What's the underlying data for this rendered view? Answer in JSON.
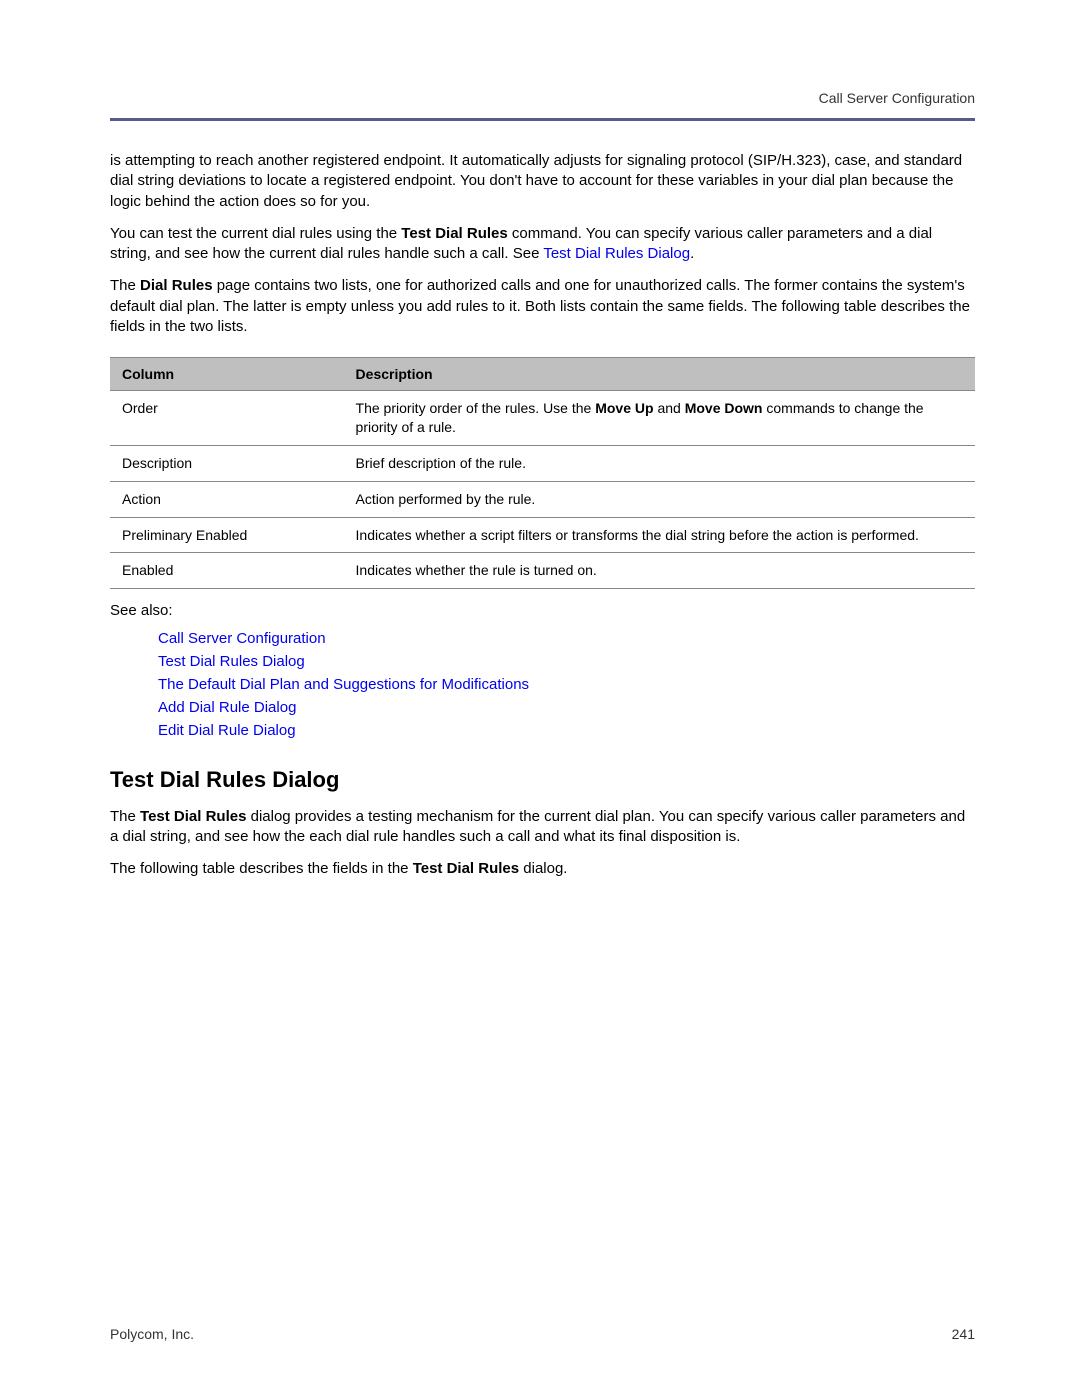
{
  "header": {
    "section": "Call Server Configuration"
  },
  "paragraphs": {
    "p1": "is attempting to reach another registered endpoint. It automatically adjusts for signaling protocol (SIP/H.323), case, and standard dial string deviations to locate a registered endpoint. You don't have to account for these variables in your dial plan because the logic behind the action does so for you.",
    "p2_a": "You can test the current dial rules using the ",
    "p2_bold": "Test Dial Rules",
    "p2_b": " command. You can specify various caller parameters and a dial string, and see how the current dial rules handle such a call. See ",
    "p2_link": "Test Dial Rules Dialog",
    "p2_c": ".",
    "p3_a": "The ",
    "p3_bold": "Dial Rules",
    "p3_b": " page contains two lists, one for authorized calls and one for unauthorized calls. The former contains the system's default dial plan. The latter is empty unless you add rules to it. Both lists contain the same fields. The following table describes the fields in the two lists.",
    "see_also_label": "See also:",
    "p4_a": "The ",
    "p4_bold": "Test Dial Rules",
    "p4_b": " dialog provides a testing mechanism for the current dial plan. You can specify various caller parameters and a dial string, and see how the each dial rule handles such a call and what its final disposition is.",
    "p5_a": "The following table describes the fields in the ",
    "p5_bold": "Test Dial Rules",
    "p5_b": " dialog."
  },
  "table": {
    "headers": {
      "c1": "Column",
      "c2": "Description"
    },
    "rows": [
      {
        "c1": "Order",
        "c2_a": "The priority order of the rules. Use the ",
        "c2_b1": "Move Up",
        "c2_mid": " and ",
        "c2_b2": "Move Down",
        "c2_b": " commands to change the priority of a rule."
      },
      {
        "c1": "Description",
        "c2": "Brief description of the rule."
      },
      {
        "c1": "Action",
        "c2": "Action performed by the rule."
      },
      {
        "c1": "Preliminary Enabled",
        "c2": "Indicates whether a script filters or transforms the dial string before the action is performed."
      },
      {
        "c1": "Enabled",
        "c2": "Indicates whether the rule is turned on."
      }
    ]
  },
  "see_also": [
    "Call Server Configuration",
    "Test Dial Rules Dialog",
    "The Default Dial Plan and Suggestions for Modifications",
    "Add Dial Rule Dialog",
    "Edit Dial Rule Dialog"
  ],
  "heading": "Test Dial Rules Dialog",
  "footer": {
    "left": "Polycom, Inc.",
    "right": "241"
  }
}
